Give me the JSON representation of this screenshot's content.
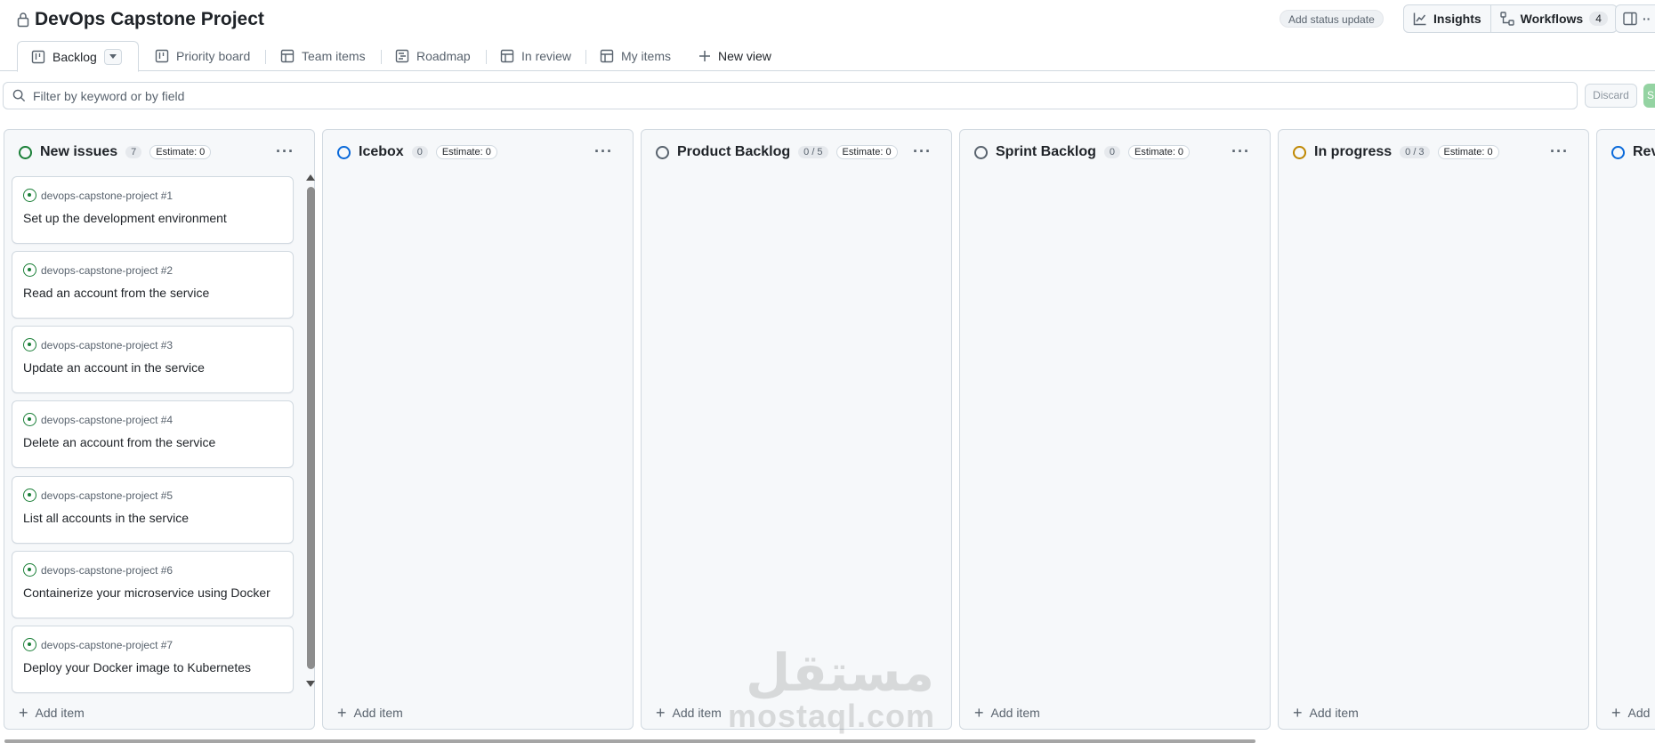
{
  "header": {
    "title": "DevOps Capstone Project",
    "status_update": "Add status update",
    "insights": "Insights",
    "workflows": "Workflows",
    "workflows_count": "4"
  },
  "tabs": [
    {
      "label": "Backlog",
      "icon": "board-icon"
    },
    {
      "label": "Priority board",
      "icon": "board-icon"
    },
    {
      "label": "Team items",
      "icon": "table-icon"
    },
    {
      "label": "Roadmap",
      "icon": "roadmap-icon"
    },
    {
      "label": "In review",
      "icon": "table-icon"
    },
    {
      "label": "My items",
      "icon": "table-icon"
    },
    {
      "label": "New view",
      "icon": "plus-icon"
    }
  ],
  "filter": {
    "placeholder": "Filter by keyword or by field",
    "discard": "Discard",
    "save": "S"
  },
  "columns": [
    {
      "name": "New issues",
      "count": "7",
      "estimate": "Estimate: 0",
      "color": "#1a7f37",
      "add": "Add item"
    },
    {
      "name": "Icebox",
      "count": "0",
      "estimate": "Estimate: 0",
      "color": "#0969da",
      "add": "Add item"
    },
    {
      "name": "Product Backlog",
      "count": "0 / 5",
      "estimate": "Estimate: 0",
      "color": "#59636e",
      "add": "Add item"
    },
    {
      "name": "Sprint Backlog",
      "count": "0",
      "estimate": "Estimate: 0",
      "color": "#59636e",
      "add": "Add item"
    },
    {
      "name": "In progress",
      "count": "0 / 3",
      "estimate": "Estimate: 0",
      "color": "#bf8700",
      "add": "Add item"
    },
    {
      "name": "Rev",
      "color": "#0969da",
      "add": "Add"
    }
  ],
  "cards": [
    {
      "repo": "devops-capstone-project #1",
      "title": "Set up the development environment"
    },
    {
      "repo": "devops-capstone-project #2",
      "title": "Read an account from the service"
    },
    {
      "repo": "devops-capstone-project #3",
      "title": "Update an account in the service"
    },
    {
      "repo": "devops-capstone-project #4",
      "title": "Delete an account from the service"
    },
    {
      "repo": "devops-capstone-project #5",
      "title": "List all accounts in the service"
    },
    {
      "repo": "devops-capstone-project #6",
      "title": "Containerize your microservice using Docker"
    },
    {
      "repo": "devops-capstone-project #7",
      "title": "Deploy your Docker image to Kubernetes"
    }
  ],
  "watermark": {
    "arabic": "مستقل",
    "latin": "mostaql.com"
  }
}
